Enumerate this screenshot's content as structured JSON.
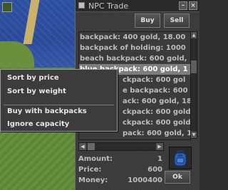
{
  "window": {
    "title": "NPC Trade",
    "minimize_glyph": "–",
    "close_glyph": "×"
  },
  "tabs": {
    "buy_label": "Buy",
    "sell_label": "Sell"
  },
  "items": [
    {
      "text": "backpack: 400 gold, 18.00",
      "selected": false
    },
    {
      "text": "backpack of holding: 1000",
      "selected": false
    },
    {
      "text": "beach backpack: 600 gold,",
      "selected": false
    },
    {
      "text": "blue backpack: 600 gold, 1",
      "selected": true
    },
    {
      "text": "ckpack: 600 gol",
      "selected": false
    },
    {
      "text": "e backpack: 600",
      "selected": false
    },
    {
      "text": "ack: 600 gold, 18.",
      "selected": false
    },
    {
      "text": "ckpack: 600 gold",
      "selected": false
    },
    {
      "text": "ckpack: 600 gold,",
      "selected": false
    },
    {
      "text": "pack: 600 gold, 1",
      "selected": false
    }
  ],
  "details": {
    "amount_label": "Amount:",
    "amount_value": "1",
    "price_label": "Price:",
    "price_value": "600",
    "money_label": "Money:",
    "money_value": "1000400"
  },
  "ok_label": "Ok",
  "selected_item_icon": "blue-backpack-icon",
  "context_menu": {
    "items": [
      "Sort by price",
      "Sort by weight",
      "Buy with backpacks",
      "Ignore capacity"
    ]
  },
  "colors": {
    "panel": "#3a3a3a",
    "selection": "#7d7d7d",
    "text": "#bdbdbd",
    "backpack": "#2f5fb8"
  }
}
